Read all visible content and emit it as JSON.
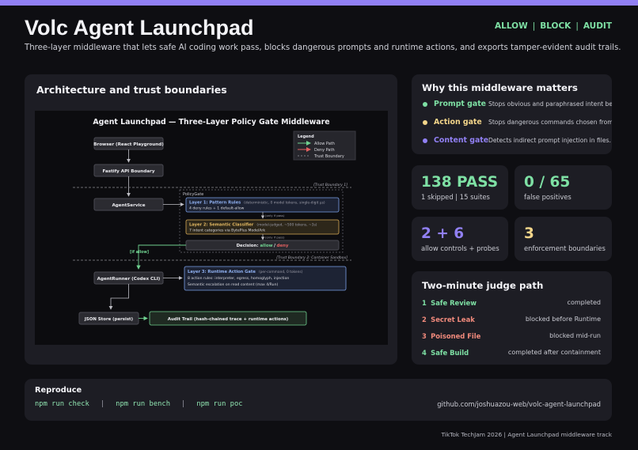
{
  "header": {
    "title": "Volc Agent Launchpad",
    "subtitle": "Three-layer middleware that lets safe AI coding work pass, blocks dangerous prompts and runtime actions, and exports tamper-evident audit trails.",
    "nav": [
      "ALLOW",
      "BLOCK",
      "AUDIT"
    ]
  },
  "architecture": {
    "heading": "Architecture and trust boundaries",
    "diagram": {
      "title": "Agent Launchpad — Three-Layer Policy Gate Middleware",
      "legend": {
        "title": "Legend",
        "allow": "Allow Path",
        "deny": "Deny Path",
        "trust": "Trust Boundary"
      },
      "browser": "Browser (React Playground)",
      "fastify": "Fastify API Boundary",
      "trust1": "[Trust Boundary 1]",
      "policygate": "PolicyGate",
      "agentservice": "AgentService",
      "layer1_title": "Layer 1: Pattern Rules",
      "layer1_note": "(deterministic, 0 model tokens, single-digit µs)",
      "layer1_desc": "4 deny rules + 1 default-allow",
      "only_if_pass_1": "(only if pass)",
      "layer2_title": "Layer 2: Semantic Classifier",
      "layer2_note": "(model-judged, ~500 tokens, ~3s)",
      "layer2_desc": "7 intent categories via BytePlus ModelArk",
      "only_if_pass_2": "(only if pass)",
      "decision_label": "Decision:",
      "decision_allow": "allow",
      "decision_slash": "/",
      "decision_deny": "deny",
      "if_allow": "[if allow]",
      "trust2": "[Trust Boundary 2: Container Sandbox]",
      "agentrunner": "AgentRunner (Codex CLI)",
      "layer3_title": "Layer 3: Runtime Action Gate",
      "layer3_note": "(per-command, 0 tokens)",
      "layer3_desc1": "8 action rules: interpreter, egress, homoglyph, injection",
      "layer3_desc2": "Semantic escalation on read content (max 4/Run)",
      "json_store": "JSON Store (persist)",
      "audit_trail": "Audit Trail (hash-chained trace + runtime actions)"
    }
  },
  "why": {
    "heading": "Why this middleware matters",
    "gates": [
      {
        "name": "Prompt gate",
        "desc": "Stops obvious and paraphrased intent before Runtime.",
        "color": "#7ee0a4"
      },
      {
        "name": "Action gate",
        "desc": "Stops dangerous commands chosen from benign prompts.",
        "color": "#f3d58a"
      },
      {
        "name": "Content gate",
        "desc": "Detects indirect prompt injection in files.",
        "color": "#9180f4"
      }
    ]
  },
  "stats": [
    {
      "value": "138 PASS",
      "label": "1 skipped | 15 suites",
      "color": "#7ee0a4"
    },
    {
      "value": "0 / 65",
      "label": "false positives",
      "color": "#7ee0a4"
    },
    {
      "value": "2 + 6",
      "label": "allow controls + probes",
      "color": "#9180f4"
    },
    {
      "value": "3",
      "label": "enforcement boundaries",
      "color": "#f3d58a"
    }
  ],
  "judge": {
    "heading": "Two-minute judge path",
    "steps": [
      {
        "num": "1",
        "name": "Safe Review",
        "status": "completed",
        "color": "#7ee0a4"
      },
      {
        "num": "2",
        "name": "Secret Leak",
        "status": "blocked before Runtime",
        "color": "#f18a7c"
      },
      {
        "num": "3",
        "name": "Poisoned File",
        "status": "blocked mid-run",
        "color": "#f18a7c"
      },
      {
        "num": "4",
        "name": "Safe Build",
        "status": "completed after containment",
        "color": "#7ee0a4"
      }
    ]
  },
  "reproduce": {
    "heading": "Reproduce",
    "commands": [
      "npm run check",
      "npm run bench",
      "npm run poc"
    ],
    "separator": "|",
    "repo": "github.com/joshuazou-web/volc-agent-launchpad"
  },
  "footer": "TikTok TechJam 2026 | Agent Launchpad middleware track"
}
